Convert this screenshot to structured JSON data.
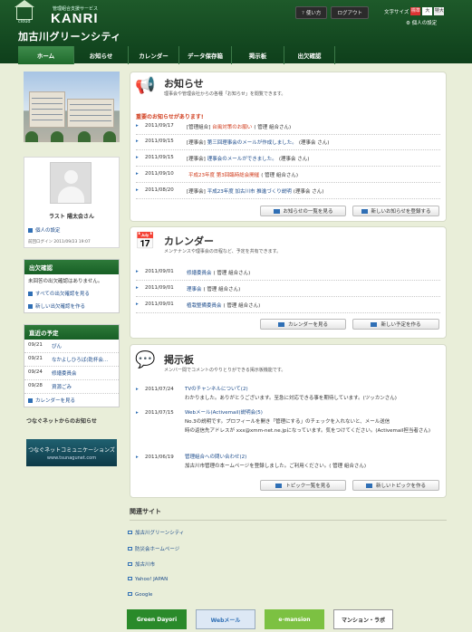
{
  "header": {
    "logo_sub": "管理組合支援サービス",
    "logo_main": "KANRI",
    "logo_cloud": "cloud",
    "site_title": "加古川グリーンシティ",
    "help_label": "使い方",
    "logout_label": "ログアウト",
    "font_size_label": "文字サイズ",
    "font_sizes": [
      "標準",
      "大",
      "特大"
    ],
    "personal_settings": "個人の設定"
  },
  "nav": {
    "items": [
      {
        "label": "ホーム"
      },
      {
        "label": "お知らせ"
      },
      {
        "label": "カレンダー"
      },
      {
        "label": "データ保存箱"
      },
      {
        "label": "掲示板"
      },
      {
        "label": "出欠確認"
      }
    ]
  },
  "profile": {
    "name": "ラスト 陽太会さん",
    "settings_link": "個人の設定",
    "last_login": "前回ログイン 2011/09/23 19:07"
  },
  "attendance": {
    "title": "出欠確認",
    "message": "未回答の出欠確認はありません。",
    "all_link": "すべての出欠確認を見る",
    "new_link": "新しい出欠確認を作る"
  },
  "schedule": {
    "title": "直近の予定",
    "items": [
      {
        "date": "09/21",
        "title": "ぴん"
      },
      {
        "date": "09/21",
        "title": "なかよしひろば(乾杯会..."
      },
      {
        "date": "09/24",
        "title": "修繕委員会"
      },
      {
        "date": "09/28",
        "title": "資源ごみ"
      }
    ],
    "more_link": "カレンダーを見る"
  },
  "tsunagu": {
    "heading": "つなぐネットからのお知らせ",
    "banner": "つなぐネットコミュニケーションズ",
    "banner_url": "www.tsunagunet.com"
  },
  "news": {
    "title": "お知らせ",
    "subtitle": "理事会や管理会社からの各種「お知らせ」を閲覧できます。",
    "important": "重要のお知らせがあります!",
    "items": [
      {
        "date": "2011/09/17",
        "tag": "[管理組合]",
        "title": "台風対策のお願い",
        "author": "( 管理 組合さん)",
        "red": true
      },
      {
        "date": "2011/09/15",
        "tag": "[理事会]",
        "title": "第三回理事会のメールが作成しました。",
        "author": "(理事会 さん)",
        "red": false
      },
      {
        "date": "2011/09/15",
        "tag": "[理事会]",
        "title": "理事会のメールができました。",
        "author": "(理事会 さん)",
        "red": false
      },
      {
        "date": "2011/09/10",
        "tag": "",
        "title": "平成23年度 第3回臨時総会開催",
        "author": "( 管理 組合さん)",
        "red": true
      },
      {
        "date": "2011/08/20",
        "tag": "[理事会]",
        "title": "平成23年度 加古川市 推進づくり説明",
        "author": "(理事会 さん)",
        "red": false
      }
    ],
    "list_btn": "お知らせの一覧を見る",
    "new_btn": "新しいお知らせを登録する"
  },
  "calendar": {
    "title": "カレンダー",
    "subtitle": "メンテナンスや理事会の日程など、予定を共有できます。",
    "items": [
      {
        "date": "2011/09/01",
        "title": "修繕委員会",
        "author": "( 管理 組合さん)"
      },
      {
        "date": "2011/09/01",
        "title": "理事会",
        "author": "( 管理 組合さん)"
      },
      {
        "date": "2011/09/01",
        "title": "植栽整備委員会",
        "author": "( 管理 組合さん)"
      }
    ],
    "view_btn": "カレンダーを見る",
    "new_btn": "新しい予定を作る"
  },
  "board": {
    "title": "掲示板",
    "subtitle": "メンバー間でコメントのやりとりができる掲示板機能です。",
    "items": [
      {
        "date": "2011/07/24",
        "title": "TVのチャンネルについて(2)",
        "body1": "わかりました。ありがとうございます。至急に対応できる事を期待しています。(ツッカンさん)",
        "body2": ""
      },
      {
        "date": "2011/07/15",
        "title": "Webメール(Activemail)説明会(5)",
        "body1": "No.3の説明です。プロフィールを開き「管理にする」のチェックを入れないと、メール送信",
        "body2": "時の返信先アドレスが xxx@xmm-net.ne.jpになっています。気をつけてください。(Activemail担当者さん)"
      },
      {
        "date": "2011/06/19",
        "title": "管理組合への問い合わせ(2)",
        "body1": "加古川市管理の本ームページを登録しました。ご利用ください。( 管理 組合さん)",
        "body2": ""
      }
    ],
    "list_btn": "トピック一覧を見る",
    "new_btn": "新しいトピックを作る"
  },
  "related": {
    "title": "関連サイト",
    "links": [
      "加古川グリーンシティ",
      "防災会ホームページ",
      "加古川市",
      "Yahoo! JAPAN",
      "Google"
    ]
  },
  "banners": [
    "Green Dayori",
    "Webメール",
    "e-mansion",
    "マンション・ラボ"
  ],
  "colors": {
    "brand_green": "#0e3f1b",
    "accent_red": "#d03a1a",
    "link_blue": "#1a4a8a"
  }
}
